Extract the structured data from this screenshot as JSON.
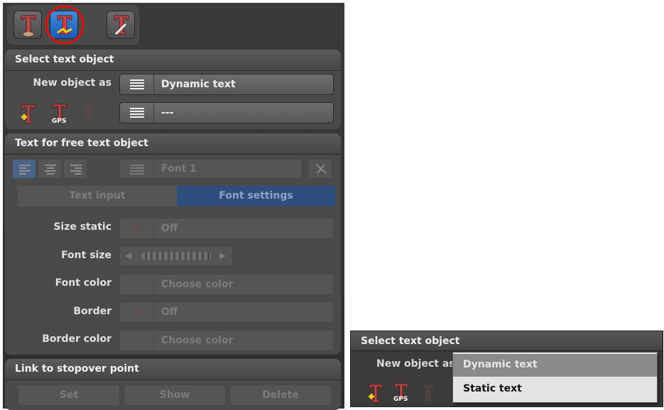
{
  "left_panel": {
    "toolbar": {
      "buttons": [
        {
          "name": "text-object-tool",
          "active": false
        },
        {
          "name": "text-edit-tool",
          "active": true,
          "highlighted": true
        },
        {
          "name": "text-settings-tool",
          "active": false
        }
      ]
    },
    "select_section": {
      "title": "Select text object",
      "new_object_label": "New object as",
      "new_object_value": "Dynamic text",
      "object_value": "---",
      "gps_label": "GPS"
    },
    "text_section": {
      "title": "Text for free text object",
      "font_value": "Font 1",
      "tabs": [
        {
          "label": "Text input",
          "active": false
        },
        {
          "label": "Font settings",
          "active": true
        }
      ],
      "size_static_label": "Size static",
      "size_static_value": "Off",
      "font_size_label": "Font size",
      "font_color_label": "Font color",
      "font_color_value": "Choose color",
      "border_label": "Border",
      "border_value": "Off",
      "border_color_label": "Border color",
      "border_color_value": "Choose color"
    },
    "link_section": {
      "title": "Link to stopover point",
      "set_label": "Set",
      "show_label": "Show",
      "delete_label": "Delete"
    }
  },
  "right_panel": {
    "title": "Select text object",
    "new_object_label": "New object as",
    "gps_label": "GPS",
    "dropdown_options": [
      "Dynamic text",
      "Static text"
    ],
    "highlighted_option": "Dynamic text"
  },
  "colors": {
    "panel_bg": "#333333",
    "section_bg": "#4a4a4a",
    "active_blue": "#2a6cc8",
    "highlight_circle": "#e01010",
    "tab_active": "#2e4e7e"
  }
}
